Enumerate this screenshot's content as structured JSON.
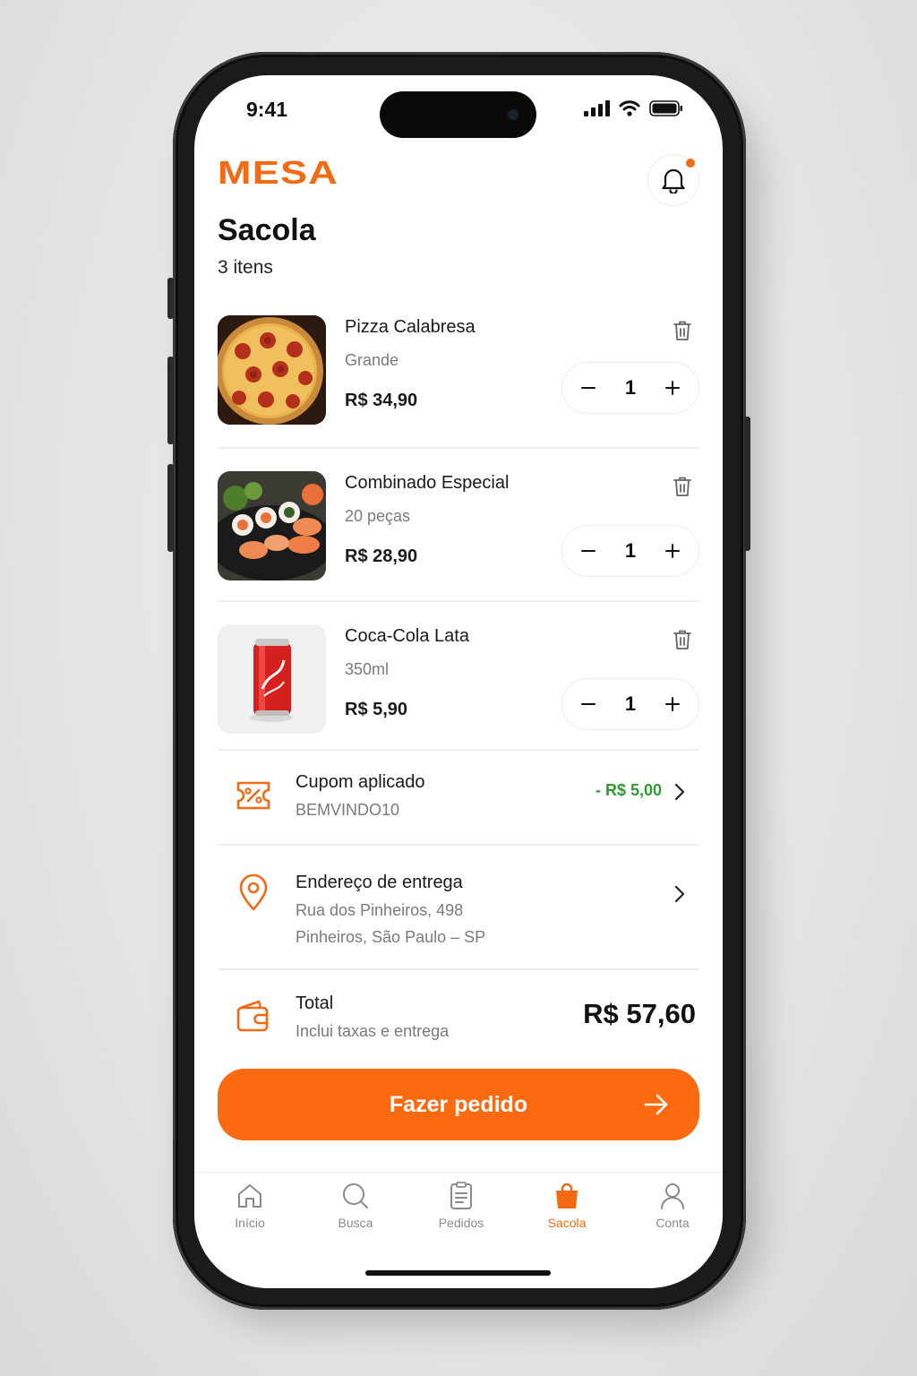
{
  "status_bar": {
    "time": "9:41"
  },
  "app": {
    "logo": "MESA",
    "brand_color": "#f26a14"
  },
  "page": {
    "title": "Sacola",
    "item_count": "3 itens"
  },
  "cart": {
    "items": [
      {
        "name": "Pizza Calabresa",
        "desc": "Grande",
        "price": "R$ 34,90",
        "qty": "1"
      },
      {
        "name": "Combinado Especial",
        "desc": "20 peças",
        "price": "R$ 28,90",
        "qty": "1"
      },
      {
        "name": "Coca-Cola Lata",
        "desc": "350ml",
        "price": "R$ 5,90",
        "qty": "1"
      }
    ]
  },
  "coupon": {
    "title": "Cupom aplicado",
    "code": "BEMVINDO10",
    "discount": "- R$ 5,00",
    "discount_color": "#2f9a2f"
  },
  "address": {
    "title": "Endereço de entrega",
    "line1": "Rua dos Pinheiros, 498",
    "line2": "Pinheiros, São Paulo – SP"
  },
  "total": {
    "title": "Total",
    "note": "Inclui taxas e entrega",
    "value": "R$ 57,60"
  },
  "cta": {
    "label": "Fazer pedido",
    "color": "#fb6a10"
  },
  "tabbar": {
    "tabs": [
      {
        "label": "Início",
        "icon": "home-icon"
      },
      {
        "label": "Busca",
        "icon": "search-icon"
      },
      {
        "label": "Pedidos",
        "icon": "receipt-icon"
      },
      {
        "label": "Sacola",
        "icon": "bag-icon",
        "active": true
      },
      {
        "label": "Conta",
        "icon": "user-icon"
      }
    ]
  }
}
